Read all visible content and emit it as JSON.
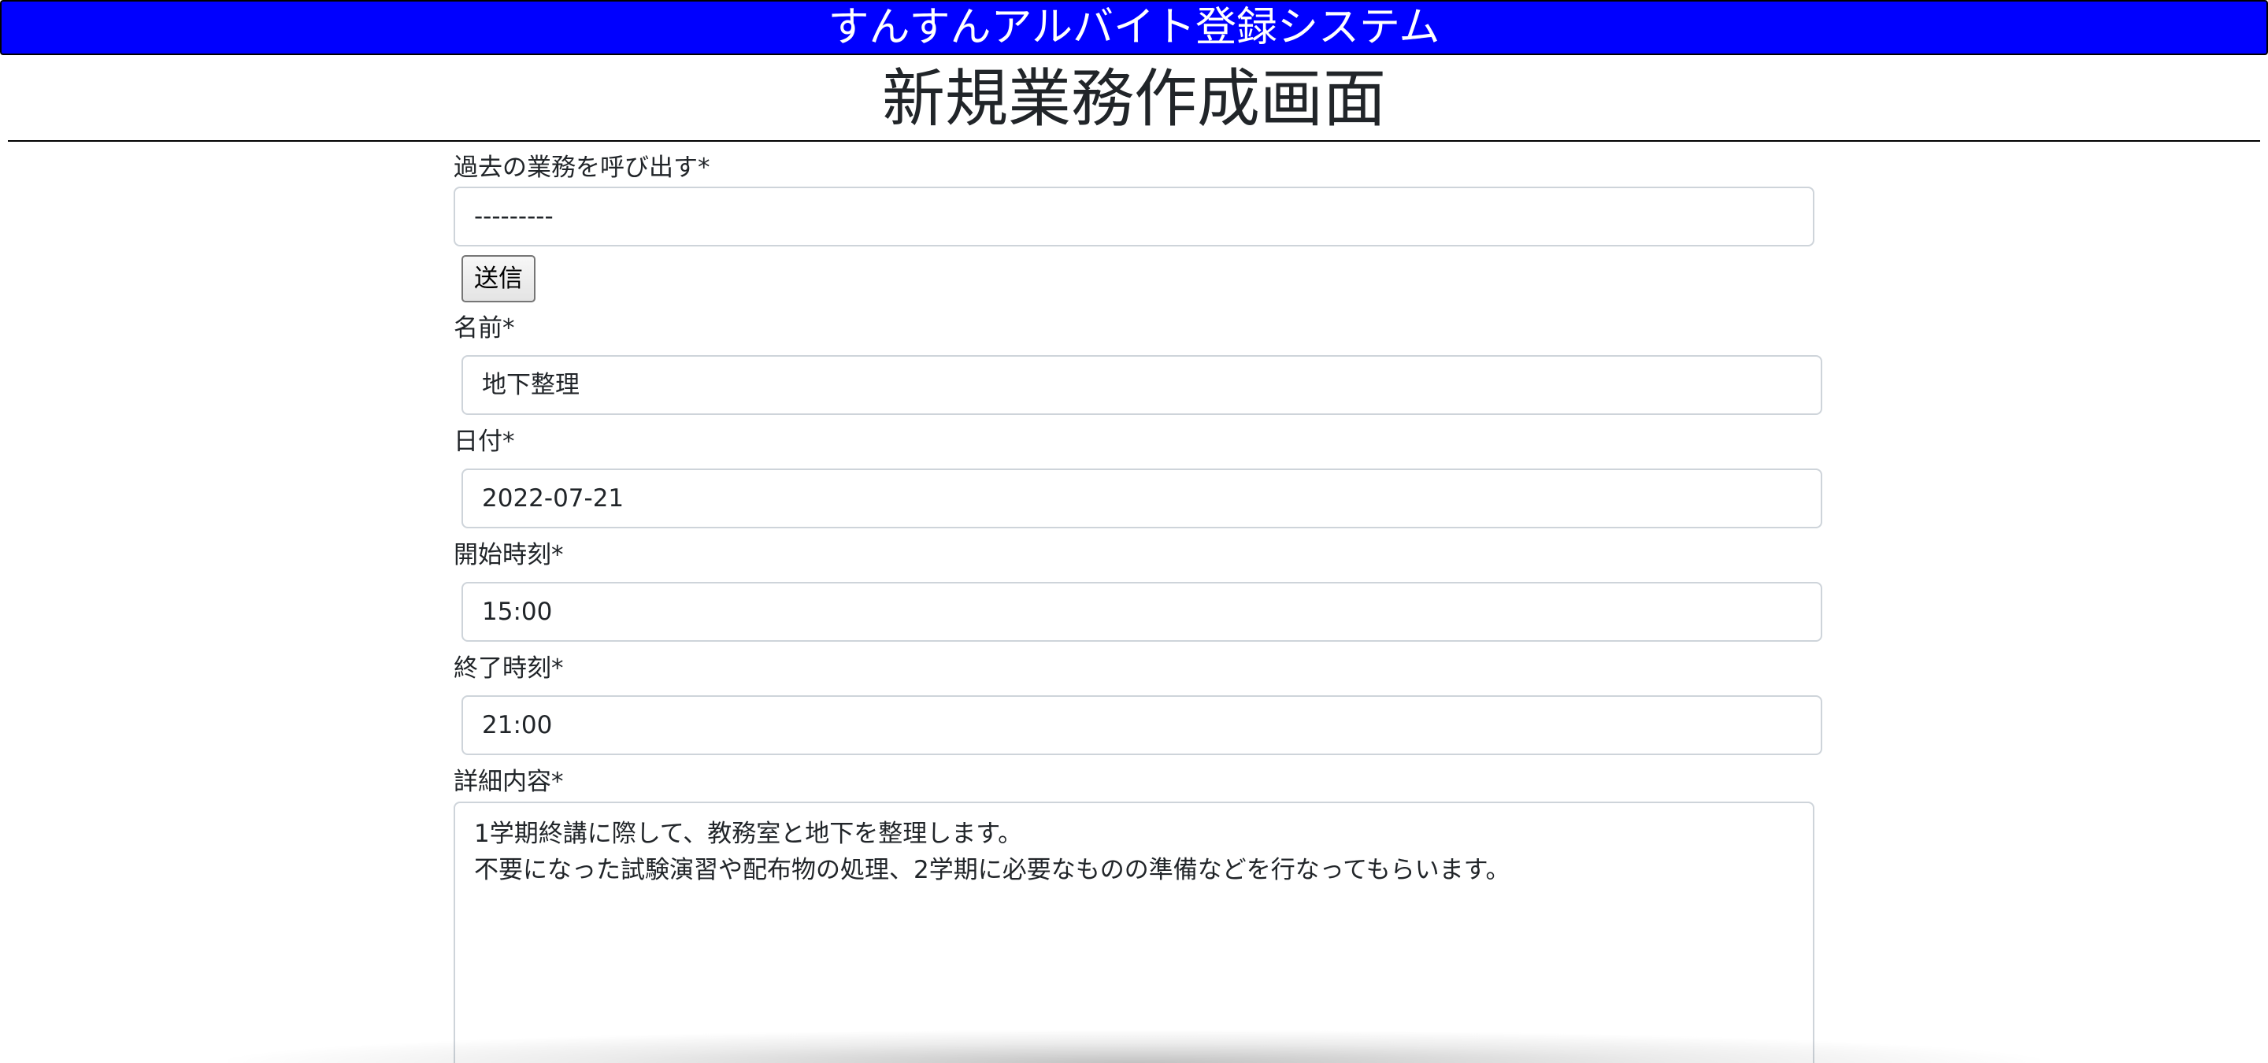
{
  "header": {
    "app_title": "すんすんアルバイト登録システム"
  },
  "page": {
    "title": "新規業務作成画面"
  },
  "form": {
    "past_job": {
      "label": "過去の業務を呼び出す*",
      "selected_value": "---------"
    },
    "submit_label": "送信",
    "name": {
      "label": "名前*",
      "value": "地下整理"
    },
    "date": {
      "label": "日付*",
      "value": "2022-07-21"
    },
    "start_time": {
      "label": "開始時刻*",
      "value": "15:00"
    },
    "end_time": {
      "label": "終了時刻*",
      "value": "21:00"
    },
    "details": {
      "label": "詳細内容*",
      "value": "1学期終講に際して、教務室と地下を整理します。\n不要になった試験演習や配布物の処理、2学期に必要なものの準備などを行なってもらいます。"
    }
  },
  "colors": {
    "header_background": "#0000ff",
    "header_text": "#ffffff",
    "field_border": "#ced4da"
  }
}
